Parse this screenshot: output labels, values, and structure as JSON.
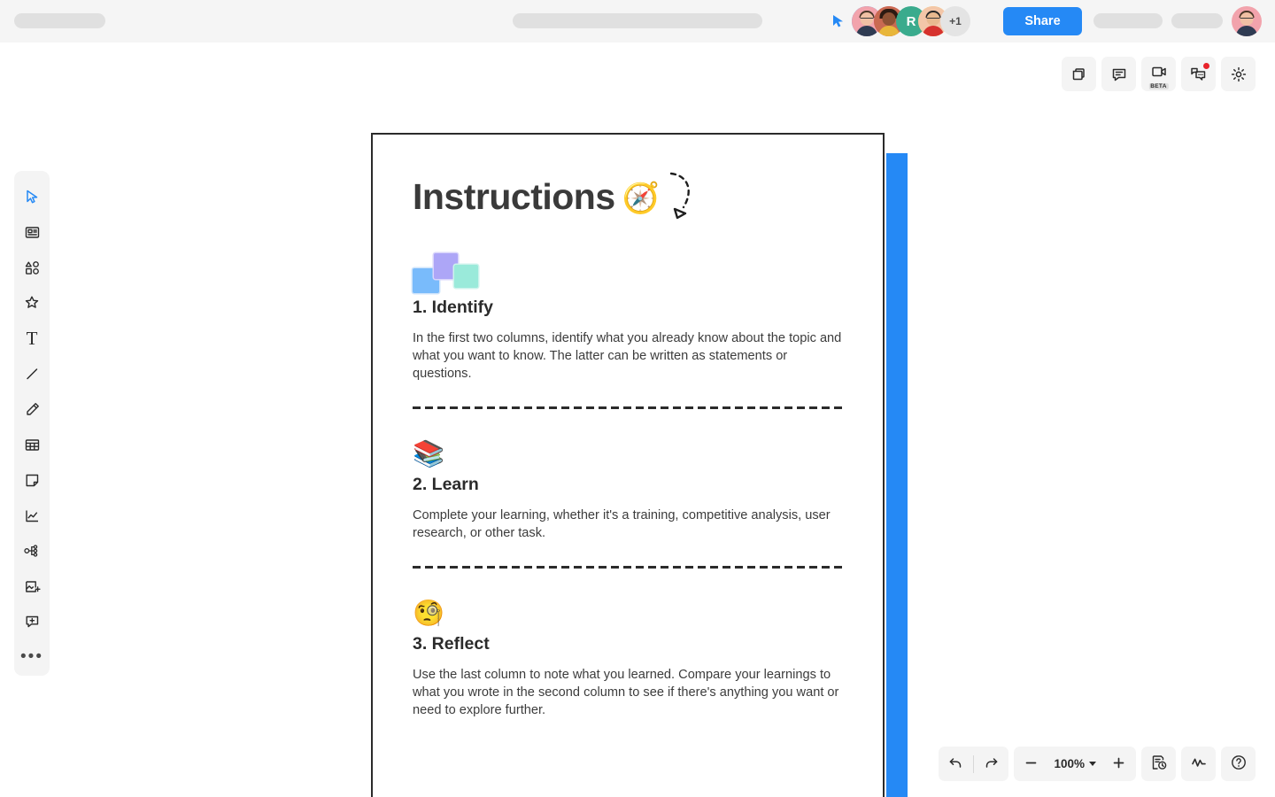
{
  "header": {
    "cursor_icon": "cursor-pointer-icon",
    "share_label": "Share",
    "collaborators": [
      {
        "type": "photo",
        "ring": "blue",
        "name": "collaborator-1"
      },
      {
        "type": "photo",
        "ring": "pink",
        "name": "collaborator-2"
      },
      {
        "type": "initial",
        "initial": "R",
        "name": "collaborator-3"
      },
      {
        "type": "photo",
        "ring": "yellow",
        "name": "collaborator-4"
      }
    ],
    "overflow_count": "+1",
    "current_user": "current-user-avatar"
  },
  "top_toolbar": {
    "buttons": [
      {
        "name": "frames-icon",
        "label": "Frames"
      },
      {
        "name": "comment-icon",
        "label": "Comment"
      },
      {
        "name": "video-icon",
        "label": "Video",
        "badge": "BETA"
      },
      {
        "name": "chat-icon",
        "label": "Chat",
        "notification": true
      },
      {
        "name": "gear-icon",
        "label": "Settings"
      }
    ]
  },
  "sidebar": {
    "tools": [
      {
        "name": "select-cursor-icon",
        "label": "Select",
        "active": true
      },
      {
        "name": "template-card-icon",
        "label": "Templates",
        "active": false
      },
      {
        "name": "shapes-icon",
        "label": "Shapes",
        "active": false
      },
      {
        "name": "sticker-star-icon",
        "label": "Stickers",
        "active": false
      },
      {
        "name": "text-icon",
        "label": "Text",
        "active": false
      },
      {
        "name": "line-icon",
        "label": "Line",
        "active": false
      },
      {
        "name": "pen-icon",
        "label": "Pen",
        "active": false
      },
      {
        "name": "table-icon",
        "label": "Table",
        "active": false
      },
      {
        "name": "sticky-note-icon",
        "label": "Sticky note",
        "active": false
      },
      {
        "name": "chart-icon",
        "label": "Chart",
        "active": false
      },
      {
        "name": "flowchart-icon",
        "label": "Diagram",
        "active": false
      },
      {
        "name": "image-add-icon",
        "label": "Image",
        "active": false
      },
      {
        "name": "comment-add-icon",
        "label": "Add comment",
        "active": false
      },
      {
        "name": "more-tools-icon",
        "label": "More"
      }
    ],
    "more_glyph": "•••"
  },
  "document": {
    "title": "Instructions",
    "title_emoji": "🧭",
    "sections": [
      {
        "icon_type": "squares",
        "icon_name": "three-squares-icon",
        "heading": "1. Identify",
        "body": "In the first two columns, identify what you already know about the topic and what you want to know. The latter can be written as statements or questions."
      },
      {
        "icon_type": "emoji",
        "icon_name": "books-icon",
        "emoji": "📚",
        "heading": "2. Learn",
        "body": "Complete your learning, whether it's a training, competitive analysis, user research, or other task."
      },
      {
        "icon_type": "emoji",
        "icon_name": "monocle-face-icon",
        "emoji": "🧐",
        "heading": "3. Reflect",
        "body": "Use the last column to note what you learned. Compare your learnings to what you wrote in the second column to see if there's anything you want or need to explore further."
      }
    ]
  },
  "bottom_toolbar": {
    "undo_label": "Undo",
    "redo_label": "Redo",
    "zoom_out_label": "−",
    "zoom_level": "100%",
    "zoom_in_label": "+",
    "buttons": [
      {
        "name": "version-history-icon",
        "label": "History"
      },
      {
        "name": "activity-pulse-icon",
        "label": "Activity"
      },
      {
        "name": "help-icon",
        "label": "Help"
      }
    ]
  },
  "colors": {
    "accent_blue": "#2589F5",
    "panel_blue": "#2589F5",
    "toolbar_bg": "#F4F4F4",
    "header_bg": "#F5F5F5",
    "frame_border": "#2B2B2B",
    "notification_red": "#E8222A"
  }
}
